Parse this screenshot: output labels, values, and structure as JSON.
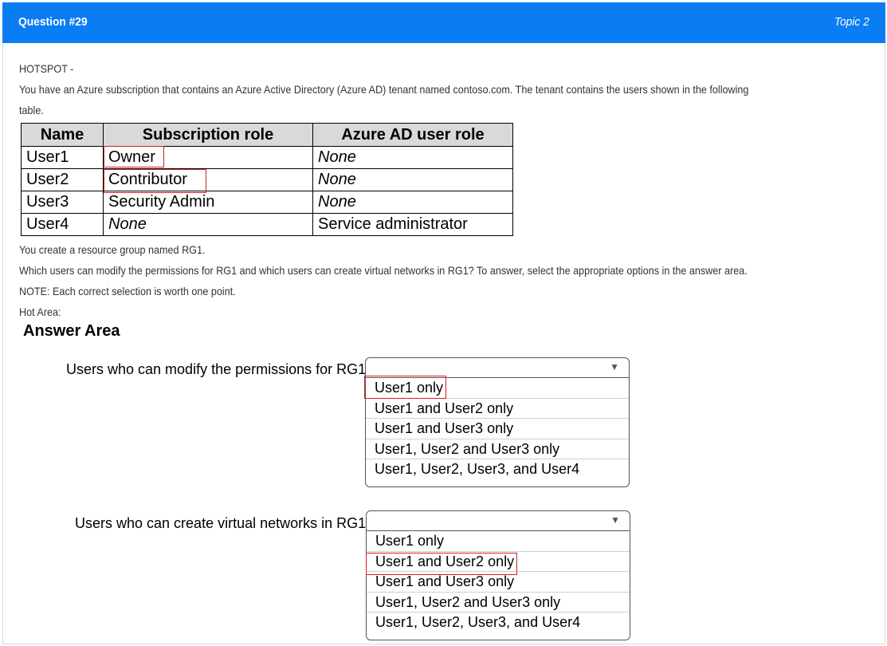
{
  "header": {
    "question": "Question #29",
    "topic": "Topic 2"
  },
  "intro": {
    "type_label": "HOTSPOT -",
    "line1": "You have an Azure subscription that contains an Azure Active Directory (Azure AD) tenant named contoso.com. The tenant contains the users shown in the following",
    "line2": "table."
  },
  "users_table": {
    "headers": [
      "Name",
      "Subscription role",
      "Azure AD user role"
    ],
    "rows": [
      [
        "User1",
        "Owner",
        "None"
      ],
      [
        "User2",
        "Contributor",
        "None"
      ],
      [
        "User3",
        "Security Admin",
        "None"
      ],
      [
        "User4",
        "None",
        "Service administrator"
      ]
    ]
  },
  "body": {
    "line1": "You create a resource group named RG1.",
    "line2": "Which users can modify the permissions for RG1 and which users can create virtual networks in RG1? To answer, select the appropriate options in the answer area.",
    "note": "NOTE: Each correct selection is worth one point.",
    "hot_area": "Hot Area:"
  },
  "answer_area": {
    "title": "Answer Area",
    "questions": [
      {
        "prompt": "Users who can modify the permissions for RG1:",
        "options": [
          "User1 only",
          "User1 and User2 only",
          "User1 and User3 only",
          "User1, User2 and User3 only",
          "User1, User2, User3, and User4"
        ],
        "selected": "User1 only"
      },
      {
        "prompt": "Users who can create virtual networks in RG1:",
        "options": [
          "User1 only",
          "User1 and User2 only",
          "User1 and User3 only",
          "User1, User2 and User3 only",
          "User1, User2, User3, and User4"
        ],
        "selected": "User1 and User2 only"
      }
    ]
  },
  "icons": {
    "dropdown_arrow": "▼"
  },
  "colors": {
    "header_bg": "#0a7cf4",
    "highlight": "#d01f2a"
  }
}
